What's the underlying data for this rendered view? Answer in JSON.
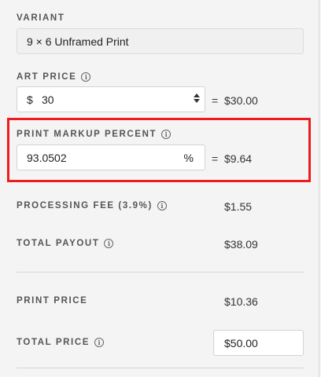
{
  "variant": {
    "label": "VARIANT",
    "value": "9 × 6  Unframed Print"
  },
  "art_price": {
    "label": "ART PRICE",
    "currency_symbol": "$",
    "input_value": "30",
    "equals": "=",
    "result": "$30.00"
  },
  "print_markup": {
    "label": "PRINT MARKUP PERCENT",
    "input_value": "93.0502",
    "unit": "%",
    "equals": "=",
    "result": "$9.64"
  },
  "processing_fee": {
    "label": "PROCESSING FEE (3.9%)",
    "value": "$1.55"
  },
  "total_payout": {
    "label": "TOTAL PAYOUT",
    "value": "$38.09"
  },
  "print_price": {
    "label": "PRINT PRICE",
    "value": "$10.36"
  },
  "total_price": {
    "label": "TOTAL PRICE",
    "input_value": "$50.00"
  },
  "icons": {
    "info": "i"
  },
  "colors": {
    "highlight": "#ee1c1c",
    "background": "#f4f4f4"
  }
}
